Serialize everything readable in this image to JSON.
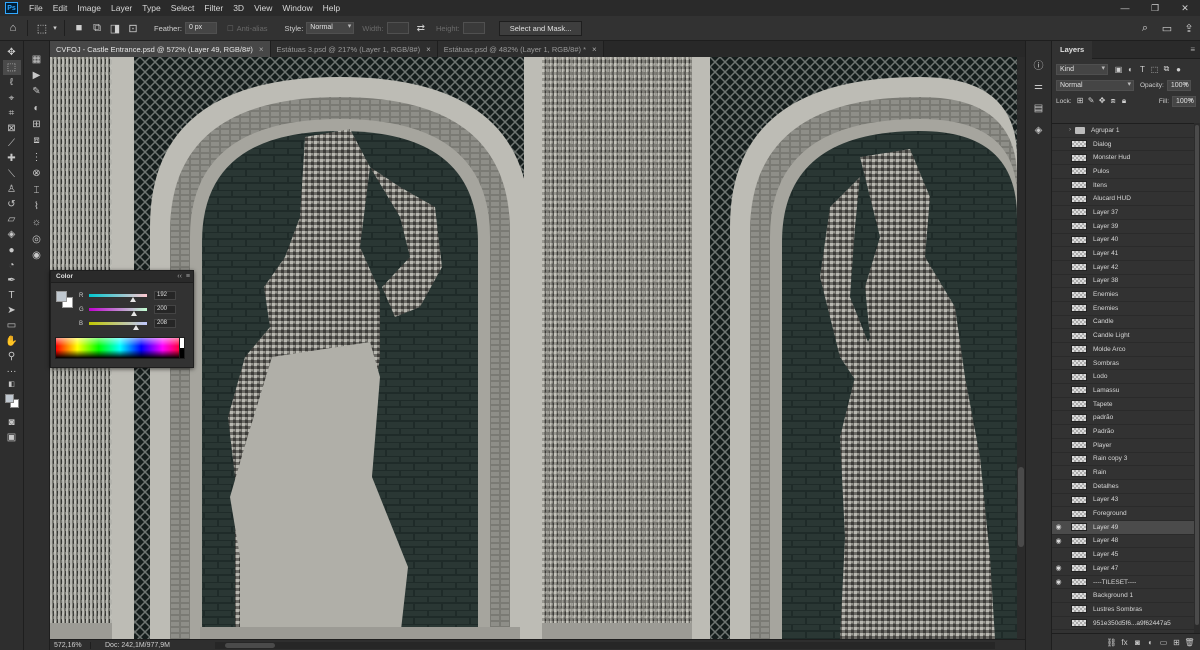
{
  "menubar": {
    "logo": "Ps",
    "items": [
      "File",
      "Edit",
      "Image",
      "Layer",
      "Type",
      "Select",
      "Filter",
      "3D",
      "View",
      "Window",
      "Help"
    ],
    "controls": [
      "—",
      "❐",
      "✕"
    ]
  },
  "options": {
    "feather_label": "Feather:",
    "feather_value": "0 px",
    "antialias_label": "Anti-alias",
    "style_label": "Style:",
    "style_value": "Normal",
    "width_label": "Width:",
    "height_label": "Height:",
    "select_mask_button": "Select and Mask..."
  },
  "tabs": [
    {
      "label": "CVFOJ - Castle Entrance.psd @ 572% (Layer 49, RGB/8#)",
      "close": "×",
      "active": true
    },
    {
      "label": "Estátuas 3.psd @ 217% (Layer 1, RGB/8#)",
      "close": "×",
      "active": false
    },
    {
      "label": "Estátuas.psd @ 482% (Layer 1, RGB/8#) *",
      "close": "×",
      "active": false
    }
  ],
  "status": {
    "zoom": "572,16%",
    "doc": "Doc: 242,1M/977,9M"
  },
  "color_panel": {
    "title": "Color",
    "collapse": "‹‹",
    "menu": "≡",
    "foreground": "#c0c8d0",
    "background": "#ffffff",
    "channels": [
      {
        "label": "R",
        "value": "192",
        "fraction": 0.753,
        "gradient": "linear-gradient(to right,#00c8d0,#ffc8d0)"
      },
      {
        "label": "G",
        "value": "200",
        "fraction": 0.784,
        "gradient": "linear-gradient(to right,#c000d0,#c0ffd0)"
      },
      {
        "label": "B",
        "value": "208",
        "fraction": 0.816,
        "gradient": "linear-gradient(to right,#c0c800,#c0c8ff)"
      }
    ]
  },
  "layers_panel": {
    "tab": "Layers",
    "filter_kind": "Kind",
    "blend_mode": "Normal",
    "opacity_label": "Opacity:",
    "opacity_value": "100%",
    "lock_label": "Lock:",
    "fill_label": "Fill:",
    "fill_value": "100%",
    "layers": [
      {
        "name": "Agrupar 1",
        "visible": false,
        "group": true,
        "selected": false
      },
      {
        "name": "Dialog",
        "visible": false,
        "group": false,
        "selected": false
      },
      {
        "name": "Monster Hud",
        "visible": false,
        "group": false,
        "selected": false
      },
      {
        "name": "Pulos",
        "visible": false,
        "group": false,
        "selected": false
      },
      {
        "name": "Itens",
        "visible": false,
        "group": false,
        "selected": false
      },
      {
        "name": "Alucard  HUD",
        "visible": false,
        "group": false,
        "selected": false
      },
      {
        "name": "Layer 37",
        "visible": false,
        "group": false,
        "selected": false
      },
      {
        "name": "Layer 39",
        "visible": false,
        "group": false,
        "selected": false
      },
      {
        "name": "Layer 40",
        "visible": false,
        "group": false,
        "selected": false
      },
      {
        "name": "Layer 41",
        "visible": false,
        "group": false,
        "selected": false
      },
      {
        "name": "Layer 42",
        "visible": false,
        "group": false,
        "selected": false
      },
      {
        "name": "Layer 38",
        "visible": false,
        "group": false,
        "selected": false
      },
      {
        "name": "Enemies",
        "visible": false,
        "group": false,
        "selected": false
      },
      {
        "name": "Enemies",
        "visible": false,
        "group": false,
        "selected": false
      },
      {
        "name": "Candle",
        "visible": false,
        "group": false,
        "selected": false
      },
      {
        "name": "Candle Light",
        "visible": false,
        "group": false,
        "selected": false
      },
      {
        "name": "Molde Arco",
        "visible": false,
        "group": false,
        "selected": false
      },
      {
        "name": "Sombras",
        "visible": false,
        "group": false,
        "selected": false
      },
      {
        "name": "Lodo",
        "visible": false,
        "group": false,
        "selected": false
      },
      {
        "name": "Lamassu",
        "visible": false,
        "group": false,
        "selected": false
      },
      {
        "name": "Tapete",
        "visible": false,
        "group": false,
        "selected": false
      },
      {
        "name": "padrão",
        "visible": false,
        "group": false,
        "selected": false
      },
      {
        "name": "Padrão",
        "visible": false,
        "group": false,
        "selected": false
      },
      {
        "name": "Player",
        "visible": false,
        "group": false,
        "selected": false
      },
      {
        "name": "Rain copy 3",
        "visible": false,
        "group": false,
        "selected": false
      },
      {
        "name": "Rain",
        "visible": false,
        "group": false,
        "selected": false
      },
      {
        "name": "Detalhes",
        "visible": false,
        "group": false,
        "selected": false
      },
      {
        "name": "Layer 43",
        "visible": false,
        "group": false,
        "selected": false
      },
      {
        "name": "Foreground",
        "visible": false,
        "group": false,
        "selected": false
      },
      {
        "name": "Layer 49",
        "visible": true,
        "group": false,
        "selected": true
      },
      {
        "name": "Layer 48",
        "visible": true,
        "group": false,
        "selected": false
      },
      {
        "name": "Layer 45",
        "visible": false,
        "group": false,
        "selected": false
      },
      {
        "name": "Layer 47",
        "visible": true,
        "group": false,
        "selected": false
      },
      {
        "name": "----TILESET----",
        "visible": true,
        "group": false,
        "selected": false
      },
      {
        "name": "Background 1",
        "visible": false,
        "group": false,
        "selected": false
      },
      {
        "name": "Lustres Sombras",
        "visible": false,
        "group": false,
        "selected": false
      },
      {
        "name": "951e350d5f6...a9f62447a5",
        "visible": false,
        "group": false,
        "selected": false
      }
    ],
    "footer_icons": [
      "link-icon",
      "fx-icon",
      "mask-icon",
      "adjustment-icon",
      "folder-icon",
      "new-layer-icon",
      "trash-icon"
    ]
  }
}
